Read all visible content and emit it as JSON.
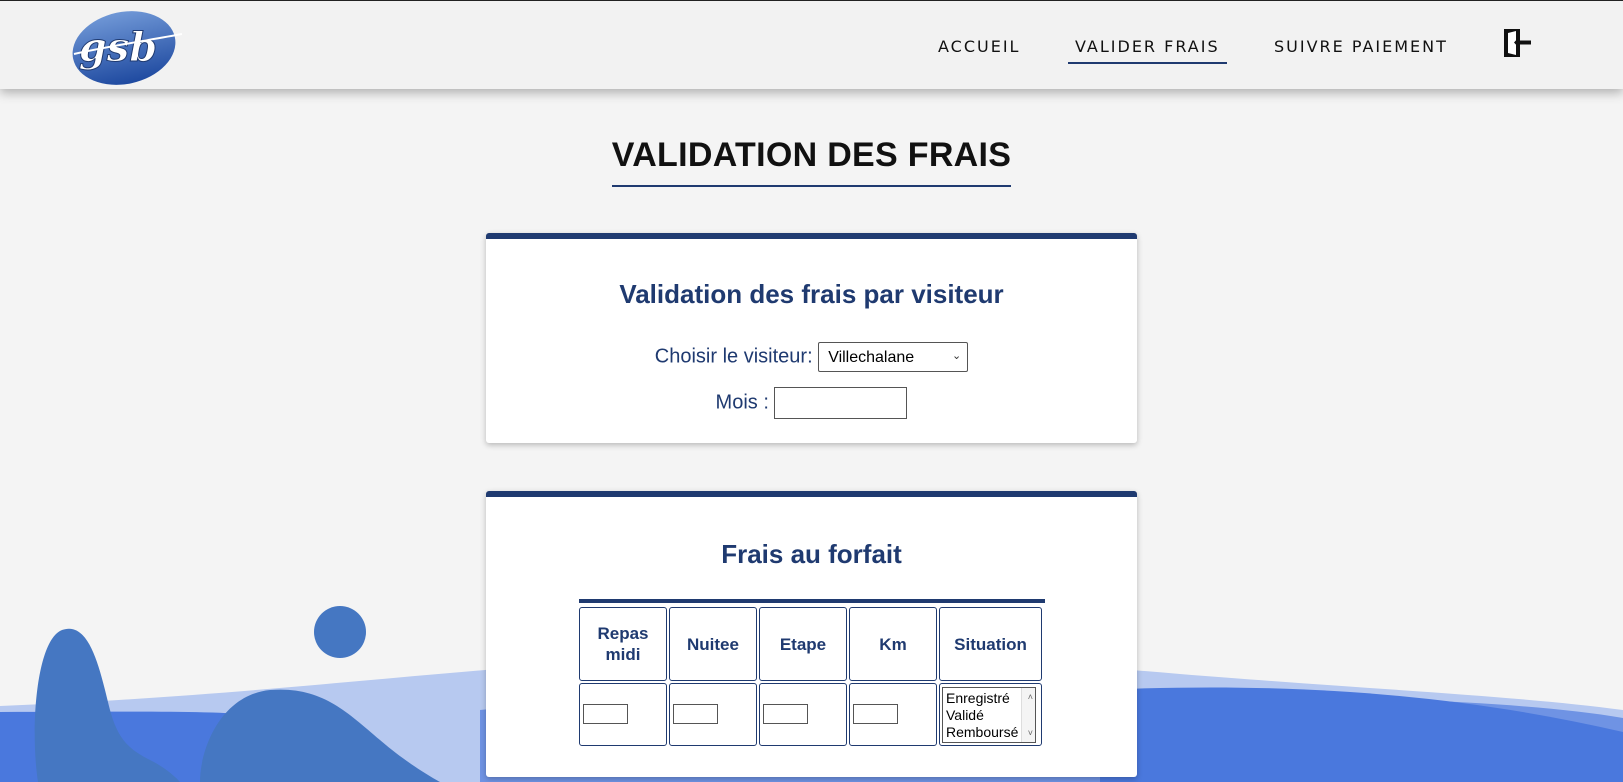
{
  "header": {
    "logo_text": "gsb",
    "nav": [
      {
        "label": "ACCUEIL"
      },
      {
        "label": "VALIDER FRAIS",
        "active": true
      },
      {
        "label": "SUIVRE PAIEMENT"
      }
    ],
    "logout_icon": "logout-door-icon"
  },
  "page_title": "VALIDATION DES FRAIS",
  "visitor_card": {
    "title": "Validation des frais par visiteur",
    "visitor_label": "Choisir le visiteur:",
    "visitor_selected": "Villechalane",
    "month_label": "Mois :",
    "month_value": ""
  },
  "forfait_card": {
    "title": "Frais au forfait",
    "columns": [
      "Repas midi",
      "Nuitee",
      "Etape",
      "Km",
      "Situation"
    ],
    "row": {
      "repas": "",
      "nuitee": "",
      "etape": "",
      "km": ""
    },
    "situation_options": [
      "Enregistré",
      "Validé",
      "Remboursé"
    ]
  },
  "colors": {
    "primary": "#1f3a70",
    "wave_light": "#aec3ee",
    "wave_mid": "#6f93e4",
    "wave_dark": "#4a78dd",
    "blob": "#4577c2"
  }
}
